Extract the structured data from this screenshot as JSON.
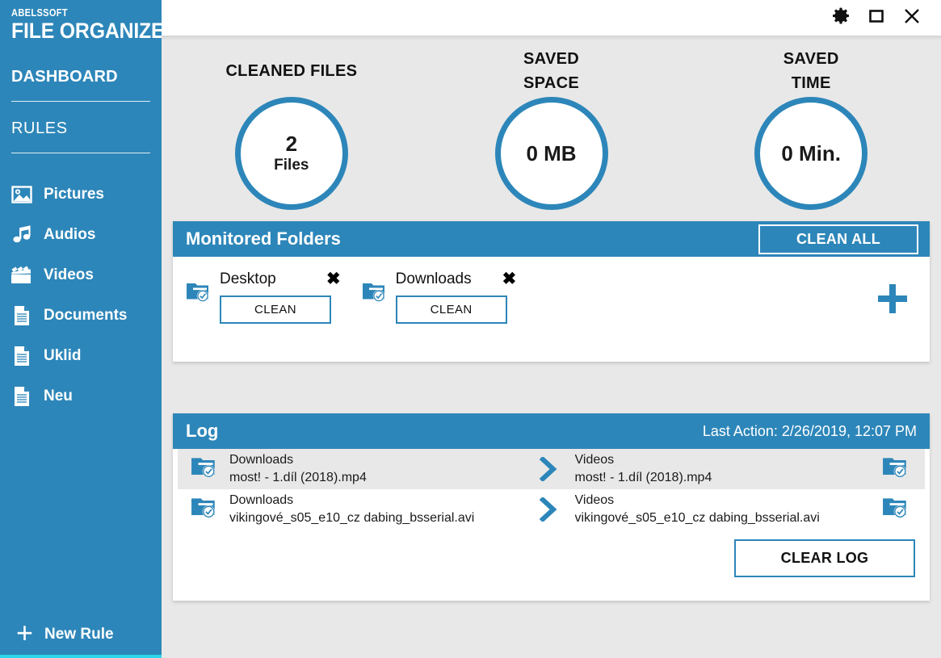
{
  "brand": {
    "company": "ABELSSOFT",
    "product": "FILE ORGANIZER"
  },
  "titlebar": {
    "settings_icon": "gear-icon",
    "maximize_icon": "maximize-icon",
    "close_icon": "close-icon"
  },
  "sidebar": {
    "dashboard_label": "DASHBOARD",
    "rules_label": "RULES",
    "rules": [
      {
        "label": "Pictures",
        "icon": "picture-icon"
      },
      {
        "label": "Audios",
        "icon": "music-note-icon"
      },
      {
        "label": "Videos",
        "icon": "clapperboard-icon"
      },
      {
        "label": "Documents",
        "icon": "document-icon"
      },
      {
        "label": "Uklid",
        "icon": "document-icon"
      },
      {
        "label": "Neu",
        "icon": "document-icon"
      }
    ],
    "new_rule_label": "New Rule",
    "new_rule_icon": "plus-icon",
    "accent_color": "#2d86b9",
    "bottom_accent_color": "#2bd6e8"
  },
  "stats": [
    {
      "title": "CLEANED FILES",
      "value": "2",
      "unit": "Files"
    },
    {
      "title": "SAVED\nSPACE",
      "value": "0 MB",
      "unit": ""
    },
    {
      "title": "SAVED\nTIME",
      "value": "0 Min.",
      "unit": ""
    }
  ],
  "stats_titles": {
    "cleaned_files": "CLEANED FILES",
    "saved_space_line1": "SAVED",
    "saved_space_line2": "SPACE",
    "saved_time_line1": "SAVED",
    "saved_time_line2": "TIME"
  },
  "monitored": {
    "title": "Monitored Folders",
    "clean_all_label": "CLEAN ALL",
    "add_icon": "plus-icon",
    "folders": [
      {
        "name": "Desktop",
        "clean_label": "CLEAN",
        "remove_icon": "close-icon",
        "icon": "folder-check-icon"
      },
      {
        "name": "Downloads",
        "clean_label": "CLEAN",
        "remove_icon": "close-icon",
        "icon": "folder-check-icon"
      }
    ]
  },
  "log": {
    "title": "Log",
    "last_action": "Last Action: 2/26/2019, 12:07 PM",
    "clear_label": "CLEAR LOG",
    "entries": [
      {
        "source_folder": "Downloads",
        "source_file": "most! - 1.díl (2018).mp4",
        "target_folder": "Videos",
        "target_file": "most! - 1.díl (2018).mp4",
        "arrow_icon": "chevron-right-icon"
      },
      {
        "source_folder": "Downloads",
        "source_file": "vikingové_s05_e10_cz dabing_bsserial.avi",
        "target_folder": "Videos",
        "target_file": "vikingové_s05_e10_cz dabing_bsserial.avi",
        "arrow_icon": "chevron-right-icon"
      }
    ]
  },
  "colors": {
    "accent": "#2d86b9",
    "background": "#e8e8e8",
    "panel": "#ffffff",
    "row_alt": "#e8e8e8"
  }
}
